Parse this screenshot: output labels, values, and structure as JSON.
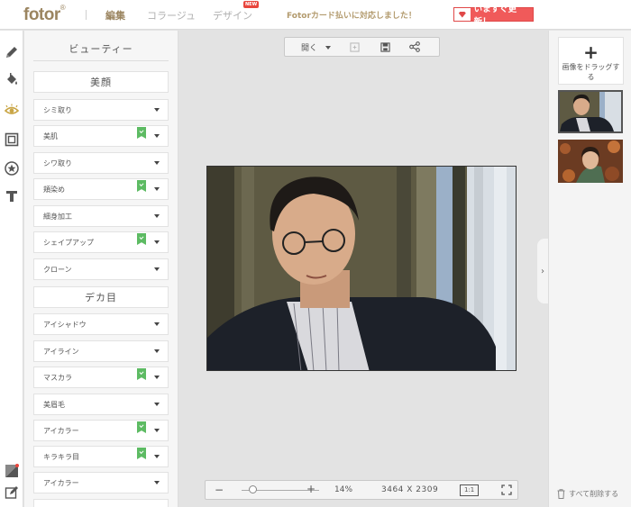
{
  "header": {
    "logo": "fotor",
    "logo_mark": "®",
    "nav": [
      {
        "label": "編集",
        "active": true
      },
      {
        "label": "コラージュ",
        "active": false
      },
      {
        "label": "デザイン",
        "active": false
      }
    ],
    "new_badge": "NEW",
    "promo": "Fotorカード払いに対応しました！",
    "update_button": "いますぐ更新！"
  },
  "toolstrip": {
    "icons": [
      "pencil-icon",
      "paint-bucket-icon",
      "eye-icon",
      "frame-icon",
      "sticker-icon",
      "text-icon",
      "crop-corner-icon",
      "edit-note-icon"
    ]
  },
  "panel": {
    "title": "ビューティー",
    "sections": [
      {
        "title": "美顔",
        "items": [
          {
            "label": "シミ取り",
            "premium": false
          },
          {
            "label": "美肌",
            "premium": true
          },
          {
            "label": "シワ取り",
            "premium": false
          },
          {
            "label": "頬染め",
            "premium": true
          },
          {
            "label": "細身加工",
            "premium": false
          },
          {
            "label": "シェイプアップ",
            "premium": true
          },
          {
            "label": "クローン",
            "premium": false
          }
        ]
      },
      {
        "title": "デカ目",
        "items": [
          {
            "label": "アイシャドウ",
            "premium": false
          },
          {
            "label": "アイライン",
            "premium": false
          },
          {
            "label": "マスカラ",
            "premium": true
          },
          {
            "label": "美眉毛",
            "premium": false
          },
          {
            "label": "アイカラー",
            "premium": true
          },
          {
            "label": "キラキラ目",
            "premium": true
          },
          {
            "label": "アイカラー",
            "premium": false
          }
        ]
      }
    ]
  },
  "canvas_toolbar": {
    "open_label": "開く",
    "icons": [
      "compare-icon",
      "save-icon",
      "share-icon"
    ]
  },
  "zoom_bar": {
    "minus": "−",
    "plus": "+",
    "zoom_percent": "14%",
    "zoom_level": 0.14,
    "dimensions": "3464 X 2309",
    "ratio_button": "1:1"
  },
  "right_panel": {
    "add_label": "画像をドラッグする",
    "add_symbol": "+",
    "delete_all": "すべて削除する",
    "collapse_symbol": "›"
  },
  "colors": {
    "brand": "#9b8560",
    "update_red": "#f05a5a",
    "premium_green": "#5dbb63"
  }
}
